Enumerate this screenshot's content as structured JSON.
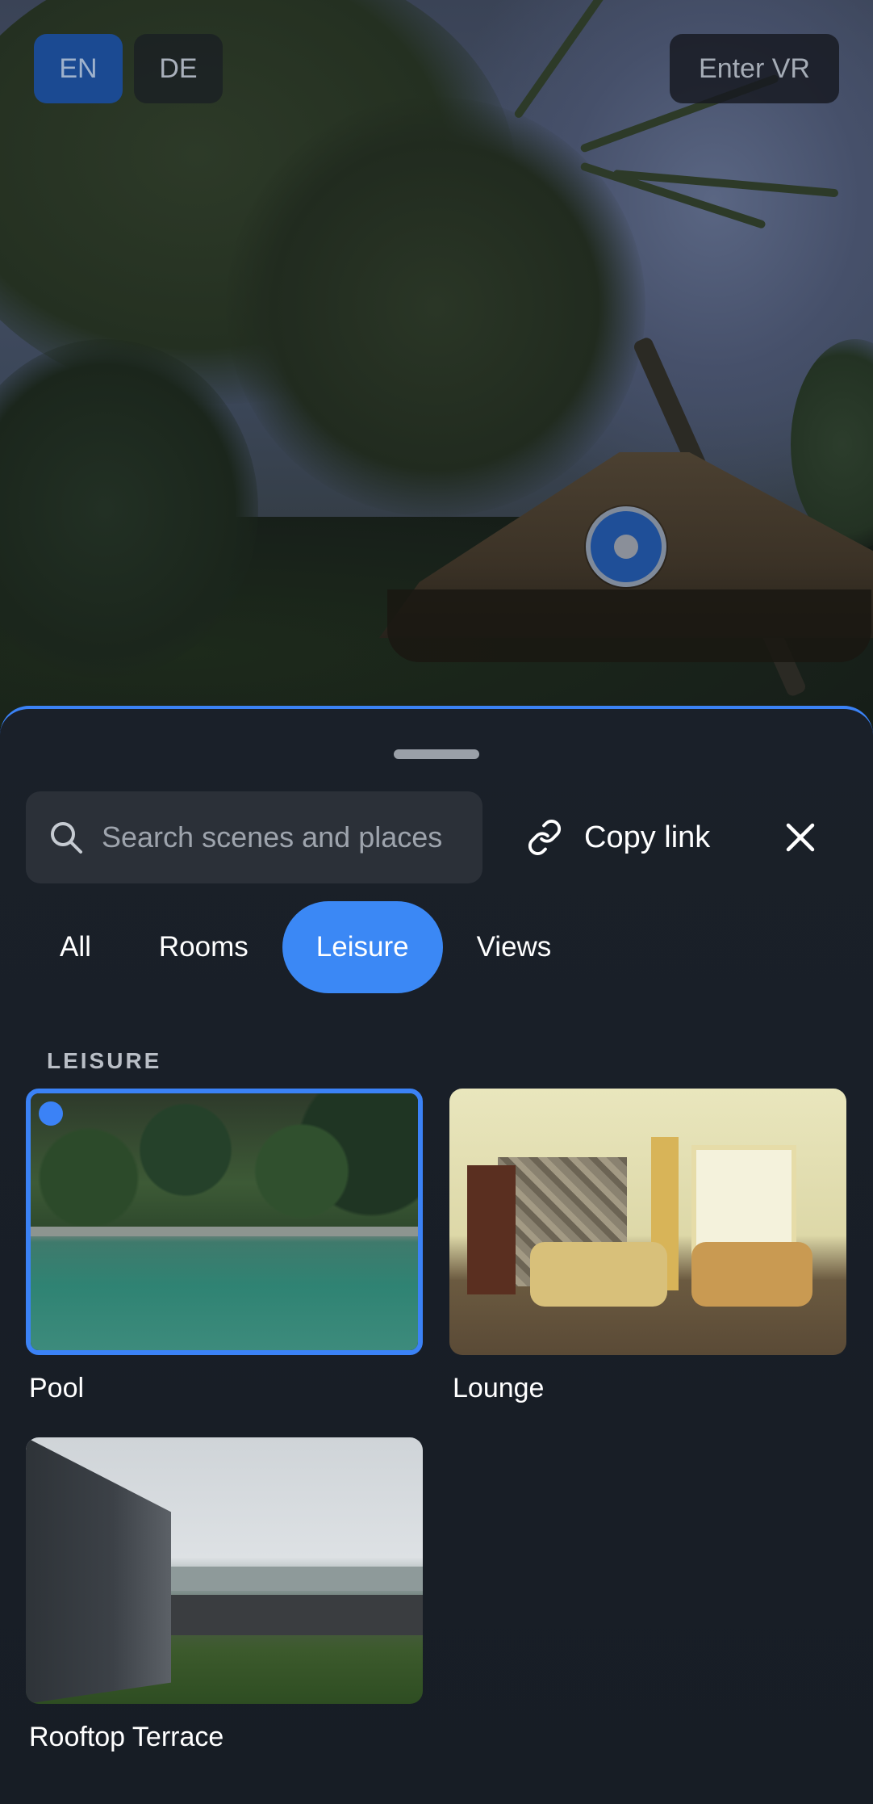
{
  "header": {
    "languages": [
      {
        "code": "EN",
        "active": true
      },
      {
        "code": "DE",
        "active": false
      }
    ],
    "vr_label": "Enter VR"
  },
  "viewer": {
    "hotspot_icon": "navigation-hotspot-icon"
  },
  "panel": {
    "search": {
      "placeholder": "Search scenes and places",
      "value": ""
    },
    "copy_link_label": "Copy link",
    "close_icon": "close-icon",
    "tabs": [
      {
        "label": "All",
        "active": false
      },
      {
        "label": "Rooms",
        "active": false
      },
      {
        "label": "Leisure",
        "active": true
      },
      {
        "label": "Views",
        "active": false
      }
    ],
    "section_title": "LEISURE",
    "scenes": [
      {
        "title": "Pool",
        "selected": true
      },
      {
        "title": "Lounge",
        "selected": false
      },
      {
        "title": "Rooftop Terrace",
        "selected": false
      }
    ]
  },
  "colors": {
    "accent": "#3b82f6",
    "sheet_bg": "#1a2029"
  }
}
